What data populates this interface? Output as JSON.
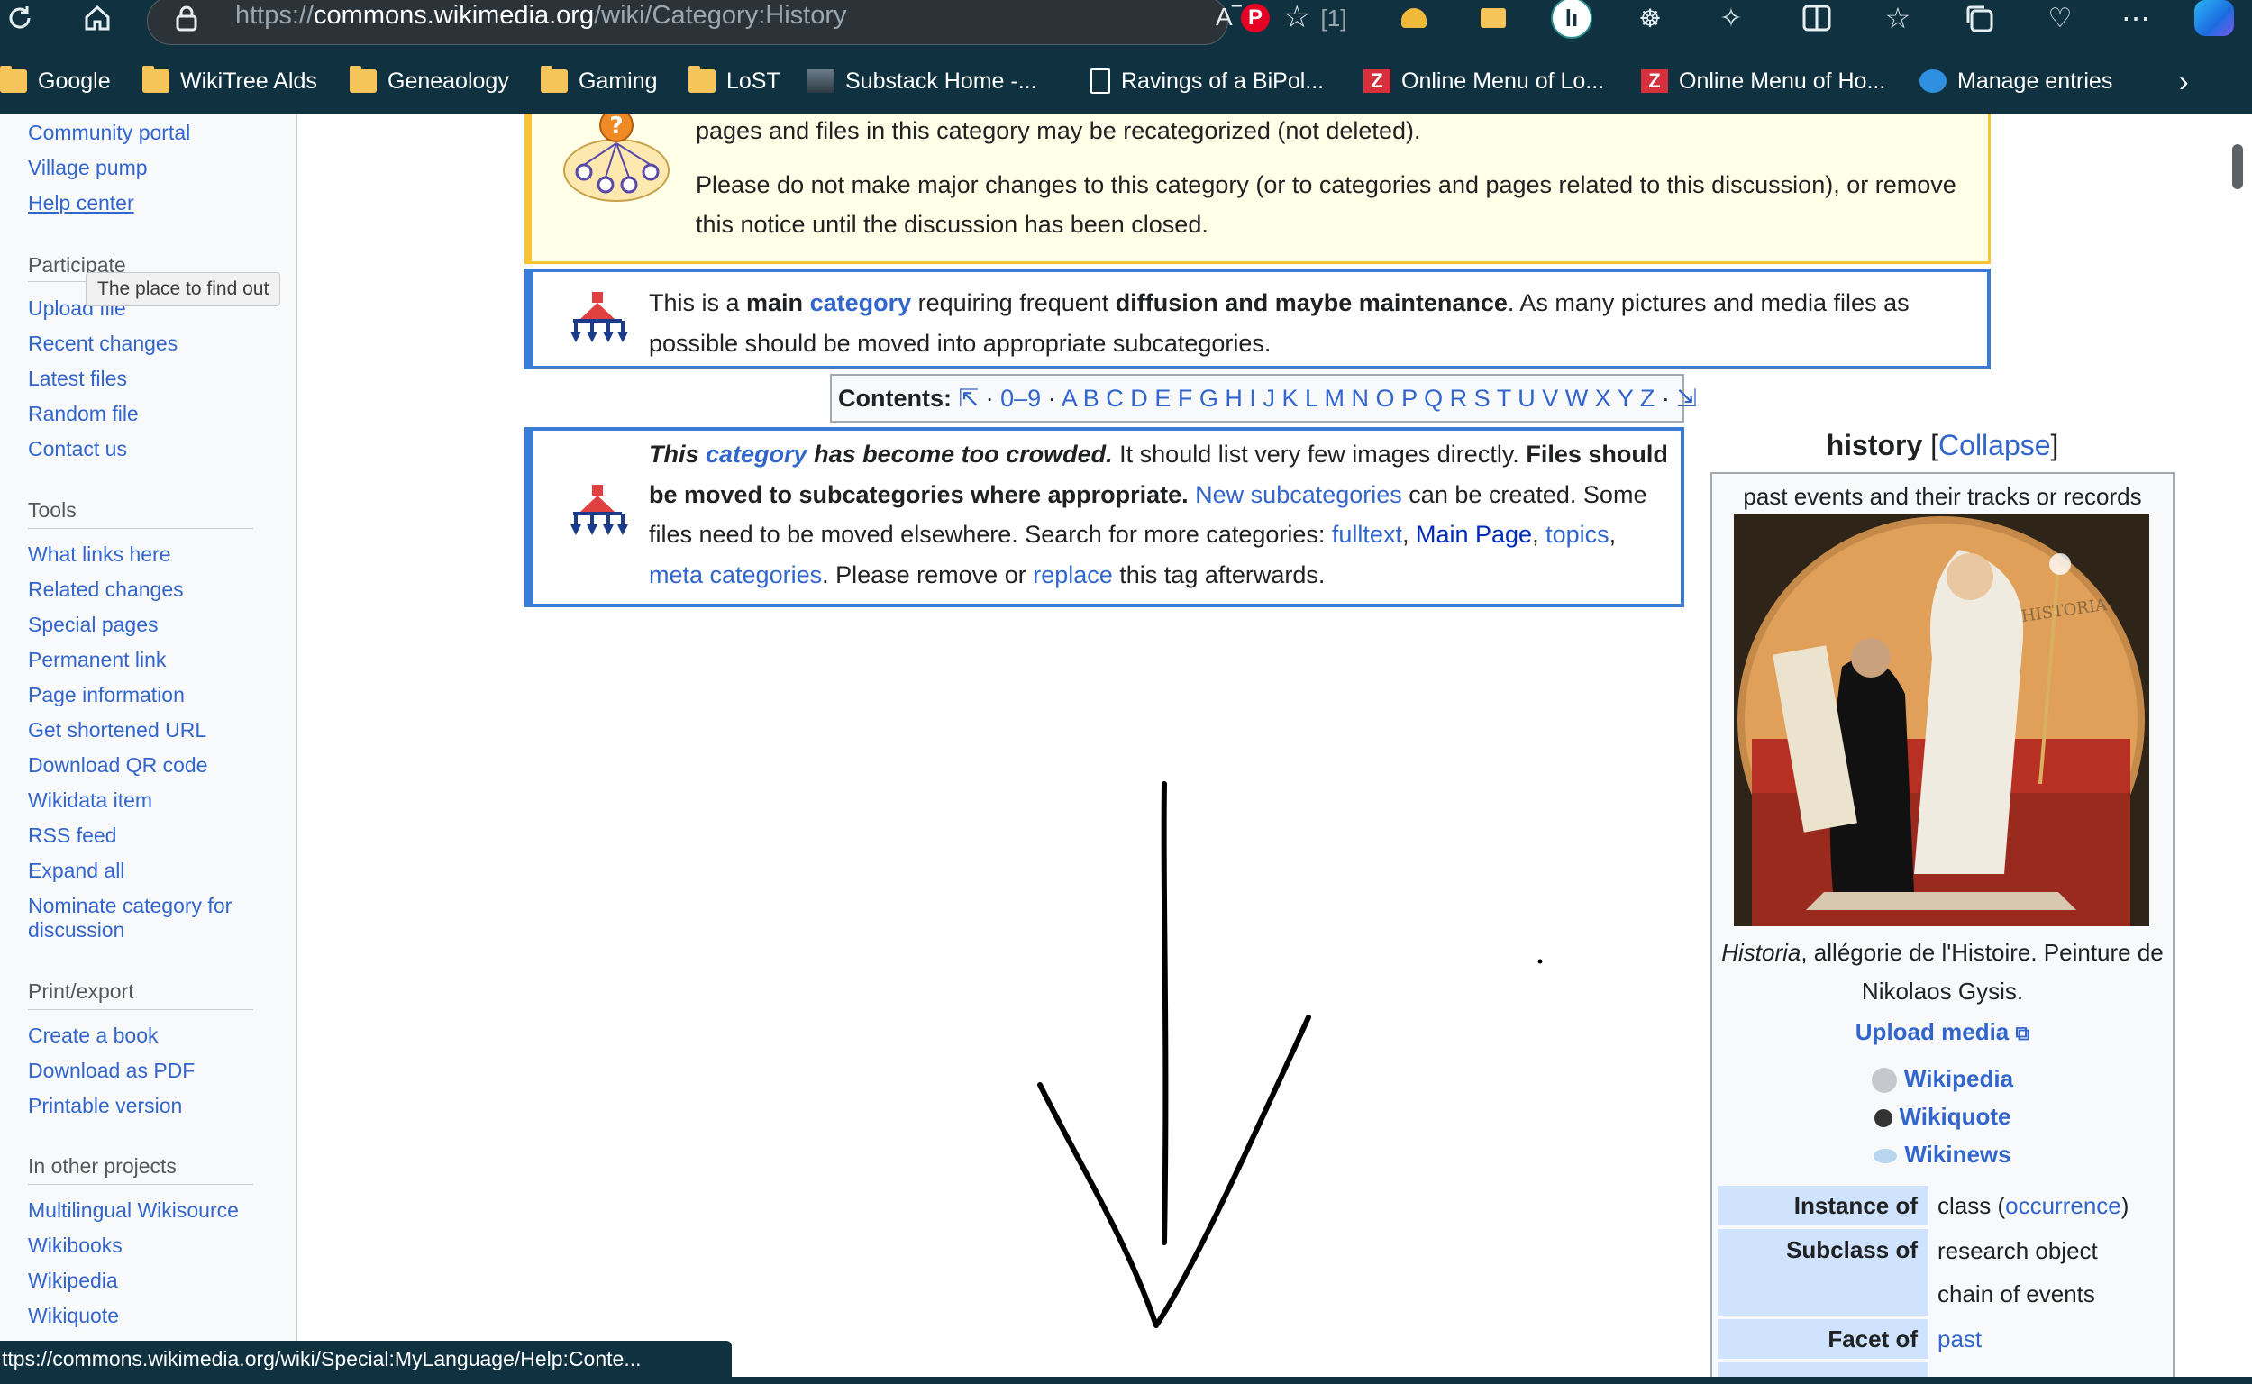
{
  "browser": {
    "url_prefix": "https://",
    "url_host": "commons.wikimedia.org",
    "url_path": "/wiki/Category:History",
    "tab_counter": "[1]",
    "bookmarks": [
      {
        "label": "Google",
        "icon": "folder-icon"
      },
      {
        "label": "WikiTree Alds",
        "icon": "folder-icon"
      },
      {
        "label": "Geneaology",
        "icon": "folder-icon"
      },
      {
        "label": "Gaming",
        "icon": "folder-icon"
      },
      {
        "label": "LoST",
        "icon": "folder-icon"
      },
      {
        "label": "Substack Home -...",
        "icon": "image-icon"
      },
      {
        "label": "Ravings of a BiPol...",
        "icon": "page-icon"
      },
      {
        "label": "Online Menu of Lo...",
        "icon": "menu-icon"
      },
      {
        "label": "Online Menu of Ho...",
        "icon": "menu-icon"
      },
      {
        "label": "Manage entries",
        "icon": "manage-icon"
      }
    ],
    "status_url": "ttps://commons.wikimedia.org/wiki/Special:MyLanguage/Help:Conte..."
  },
  "sidebar": {
    "top_links": [
      "Community portal",
      "Village pump",
      "Help center"
    ],
    "participate_heading": "Participate",
    "participate_links": [
      "Upload file",
      "Recent changes",
      "Latest files",
      "Random file",
      "Contact us"
    ],
    "tooltip": "The place to find out",
    "tools_heading": "Tools",
    "tools_links": [
      "What links here",
      "Related changes",
      "Special pages",
      "Permanent link",
      "Page information",
      "Get shortened URL",
      "Download QR code",
      "Wikidata item",
      "RSS feed",
      "Expand all",
      "Nominate category for",
      "discussion"
    ],
    "print_heading": "Print/export",
    "print_links": [
      "Create a book",
      "Download as PDF",
      "Printable version"
    ],
    "other_heading": "In other projects",
    "other_links": [
      "Multilingual Wikisource",
      "Wikibooks",
      "Wikipedia",
      "Wikiquote"
    ]
  },
  "discussion_notice": {
    "line1": "pages and files in this category may be recategorized (not deleted).",
    "line2": "Please do not make major changes to this category (or to categories and pages related to this discussion), or remove this notice until the discussion has been closed."
  },
  "main_notice": {
    "t1": "This is a ",
    "b1": "main",
    "l1": "category",
    "t2": " requiring frequent ",
    "b2": "diffusion and maybe maintenance",
    "t3": ". As many pictures and media files as possible should be moved into appropriate subcategories."
  },
  "contents": {
    "label": "Contents:",
    "top": "⇱",
    "digits": "0–9",
    "letters": [
      "A",
      "B",
      "C",
      "D",
      "E",
      "F",
      "G",
      "H",
      "I",
      "J",
      "K",
      "L",
      "M",
      "N",
      "O",
      "P",
      "Q",
      "R",
      "S",
      "T",
      "U",
      "V",
      "W",
      "X",
      "Y",
      "Z"
    ],
    "bottom": "⇲"
  },
  "crowd_notice": {
    "bi1": "This ",
    "l1": "category",
    "bi2": " has become too crowded.",
    "t1": " It should list very few images directly. ",
    "b1": "Files should be moved to subcategories where appropriate.",
    "l2": "New subcategories",
    "t2": " can be created. Some files need to be moved elsewhere. Search for more categories: ",
    "l3": "fulltext",
    "l4": "Main Page",
    "l5": "topics",
    "l6": "meta categories",
    "t3": ". Please remove or ",
    "l7": "replace",
    "t4": " this tag afterwards."
  },
  "infobox": {
    "title": "history",
    "collapse": "Collapse",
    "description": "past events and their tracks or records",
    "caption_italic": "Historia",
    "caption_rest": ", allégorie de l'Histoire. Peinture de Nikolaos Gysis.",
    "upload": "Upload media",
    "projects": [
      "Wikipedia",
      "Wikiquote",
      "Wikinews"
    ],
    "rows": [
      {
        "label": "Instance of",
        "value_pre": "class (",
        "value_link": "occurrence",
        "value_post": ")"
      },
      {
        "label": "Subclass of",
        "value1": "research object",
        "value2": "chain of events"
      },
      {
        "label": "Facet of",
        "value_link": "past"
      }
    ],
    "image_inscription": "HISTORIA"
  }
}
